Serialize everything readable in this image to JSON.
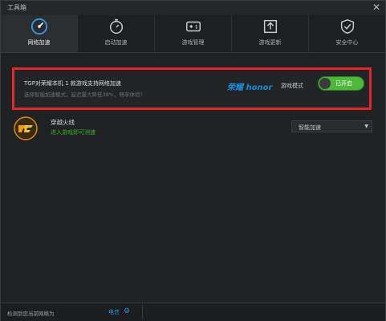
{
  "window": {
    "title": "工具箱",
    "close_glyph": "✕"
  },
  "tabs": [
    {
      "label": "网络加速",
      "icon": "speedometer-icon",
      "active": true
    },
    {
      "label": "启动加速",
      "icon": "stopwatch-icon",
      "active": false
    },
    {
      "label": "游戏管理",
      "icon": "gamepad-icon",
      "active": false
    },
    {
      "label": "游戏更新",
      "icon": "upload-icon",
      "active": false
    },
    {
      "label": "安全中心",
      "icon": "shield-icon",
      "active": false
    }
  ],
  "promo": {
    "title": "TGP对荣耀本机 1 款游戏支持网络加速",
    "subtitle": "选择智能加速模式，延迟最大降低38%，畅享体验！",
    "brand": "荣耀 honor",
    "mode_label": "游戏模式",
    "toggle_label": "已开启",
    "toggle_on": true,
    "highlight_color": "#e3262c"
  },
  "game": {
    "name": "穿越火线",
    "status": "进入游戏即可测速",
    "mode_select": "智能加速",
    "status_color": "#3fae2e"
  },
  "footer": {
    "status_text": "检测到您当前网络为",
    "network_link": "电信"
  },
  "colors": {
    "accent": "#1f8ad6",
    "toggle_on": "#4fb83a"
  }
}
